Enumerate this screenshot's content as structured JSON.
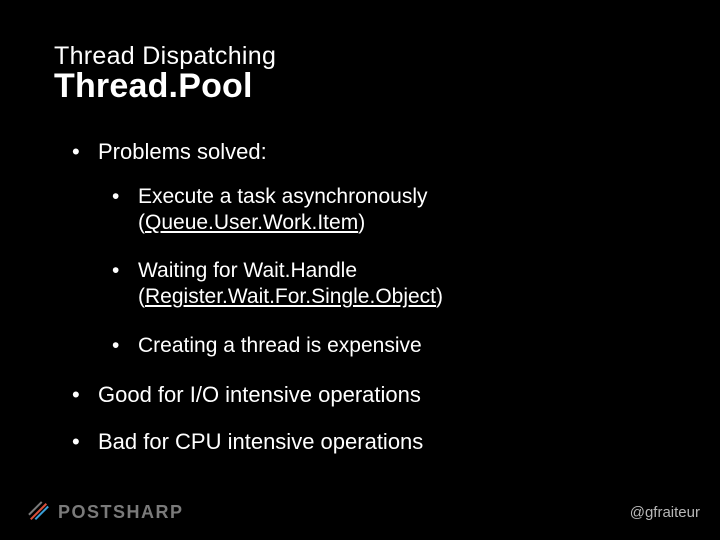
{
  "header": {
    "subtitle": "Thread Dispatching",
    "title": "Thread.Pool"
  },
  "bullets": [
    {
      "text": "Problems solved:",
      "children": [
        {
          "text": "Execute a task asynchronously",
          "paren_underlined": "Queue.User.Work.Item"
        },
        {
          "text": "Waiting for Wait.Handle",
          "paren_underlined": "Register.Wait.For.Single.Object"
        },
        {
          "text": "Creating a thread is expensive"
        }
      ]
    },
    {
      "text": "Good for I/O intensive operations"
    },
    {
      "text": "Bad for CPU intensive operations"
    }
  ],
  "footer": {
    "brand": "POSTSHARP",
    "handle": "@gfraiteur"
  },
  "colors": {
    "bg": "#000000",
    "fg": "#ffffff",
    "brand_gray": "#7a7a7a",
    "handle_gray": "#b8b8b8",
    "accent1": "#d94f3a",
    "accent2": "#3aa0d9"
  }
}
